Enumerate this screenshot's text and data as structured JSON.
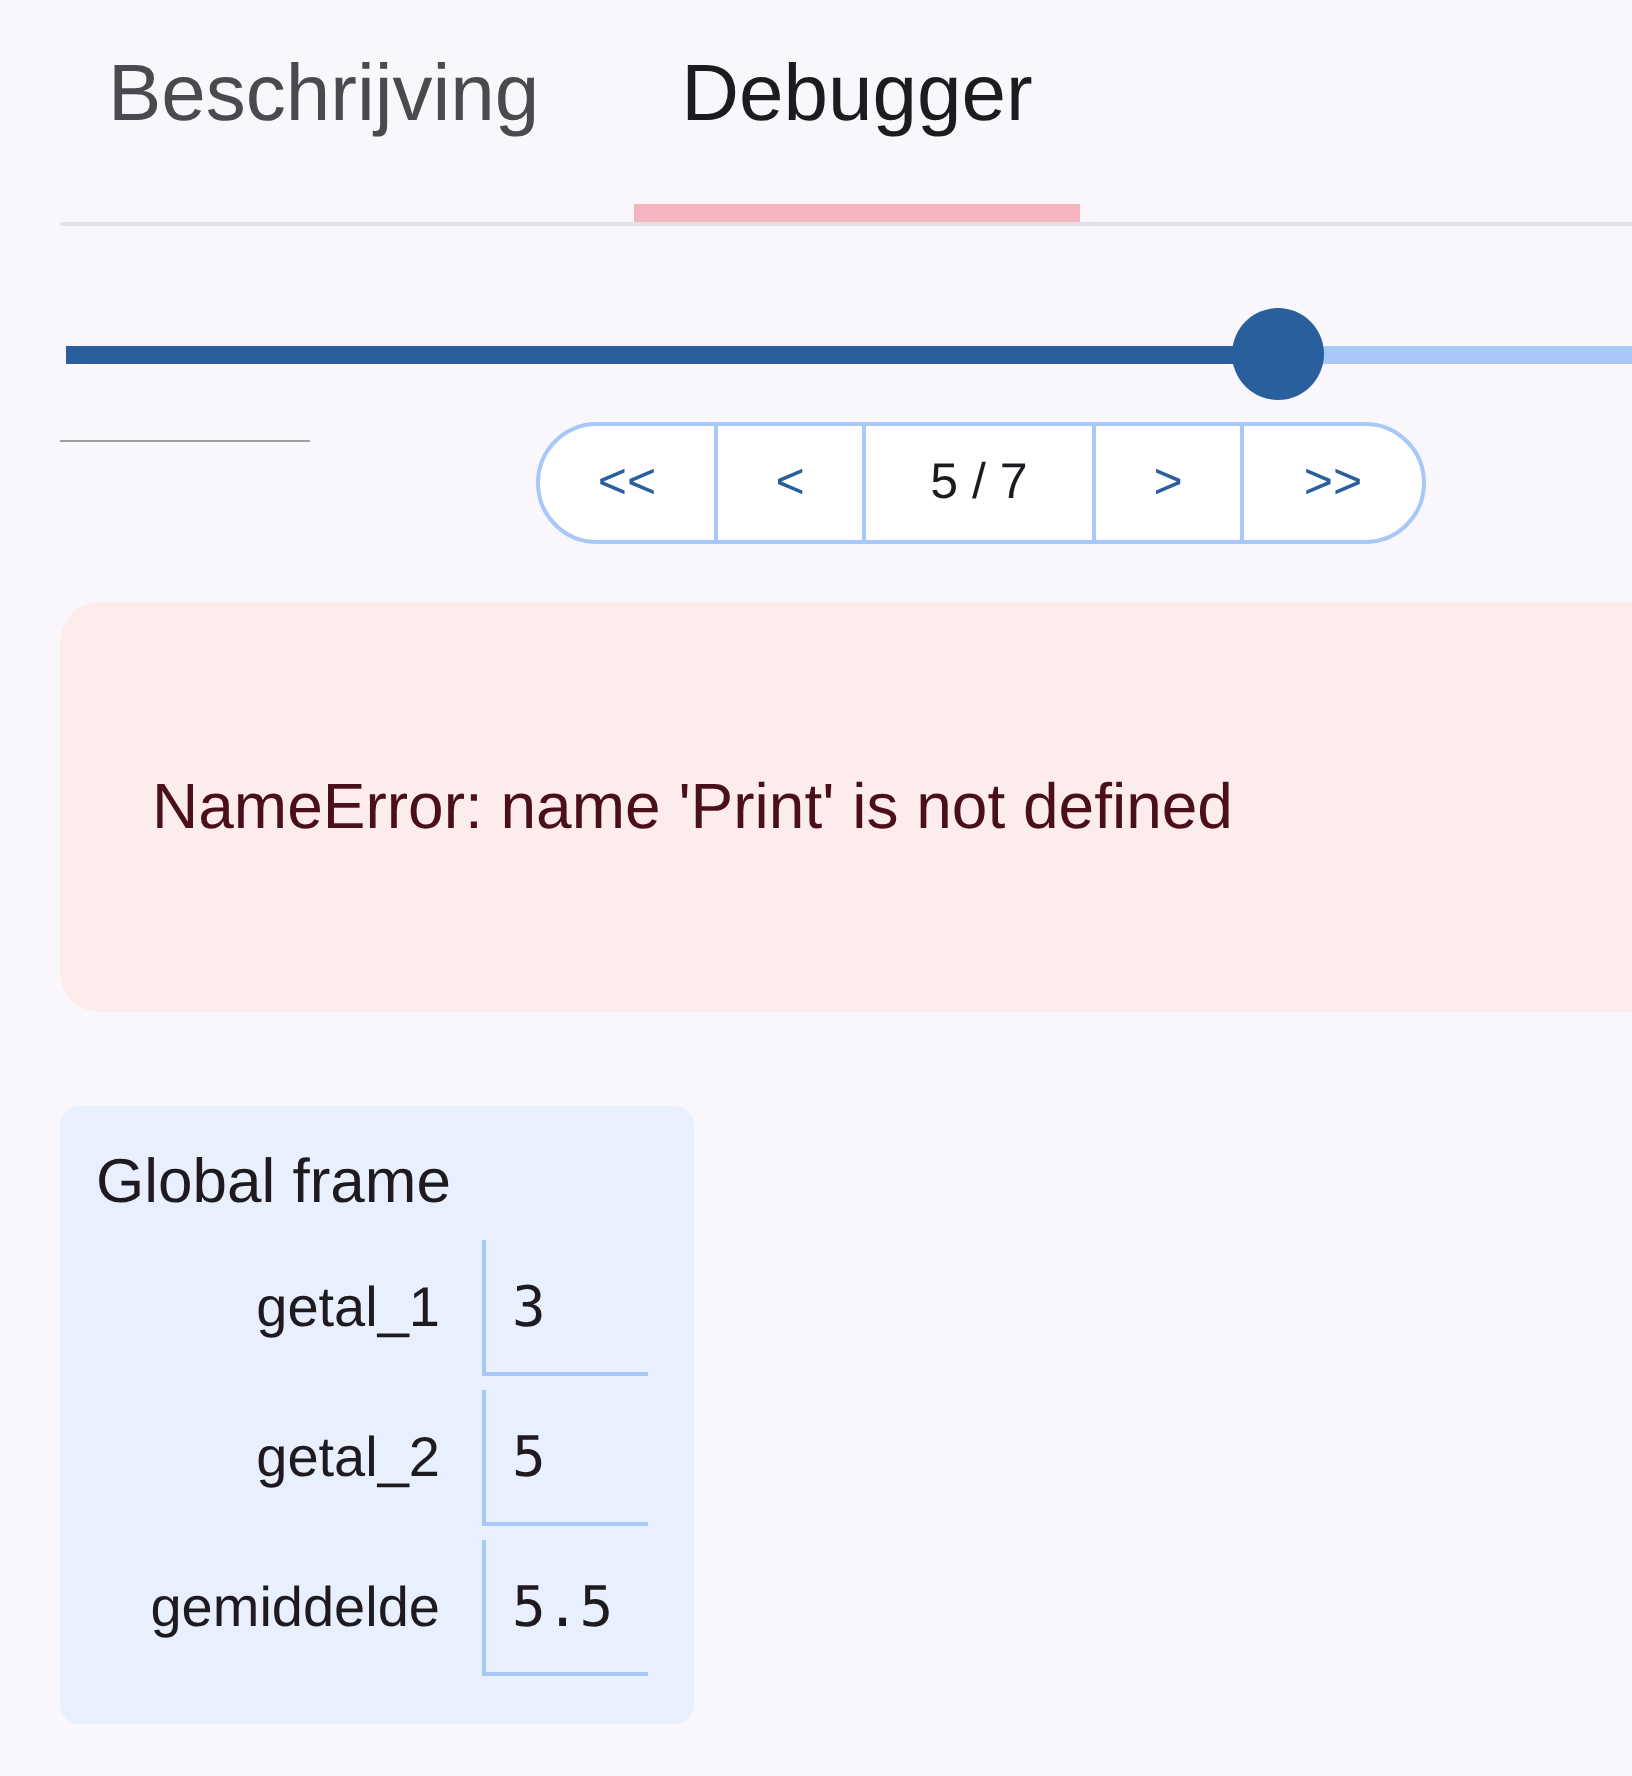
{
  "tabs": [
    {
      "label": "Beschrijving",
      "selected": false
    },
    {
      "label": "Debugger",
      "selected": true
    }
  ],
  "step_slider": {
    "level": 0.774
  },
  "pager": {
    "first": "<<",
    "previous": "<",
    "position": "5 / 7",
    "next": ">",
    "last": ">>"
  },
  "error": {
    "message": "NameError: name 'Print' is not defined"
  },
  "frame": {
    "title": "Global frame",
    "variables": [
      {
        "name": "getal_1",
        "value": "3"
      },
      {
        "name": "getal_2",
        "value": "5"
      },
      {
        "name": "gemiddelde",
        "value": "5.5"
      }
    ]
  }
}
